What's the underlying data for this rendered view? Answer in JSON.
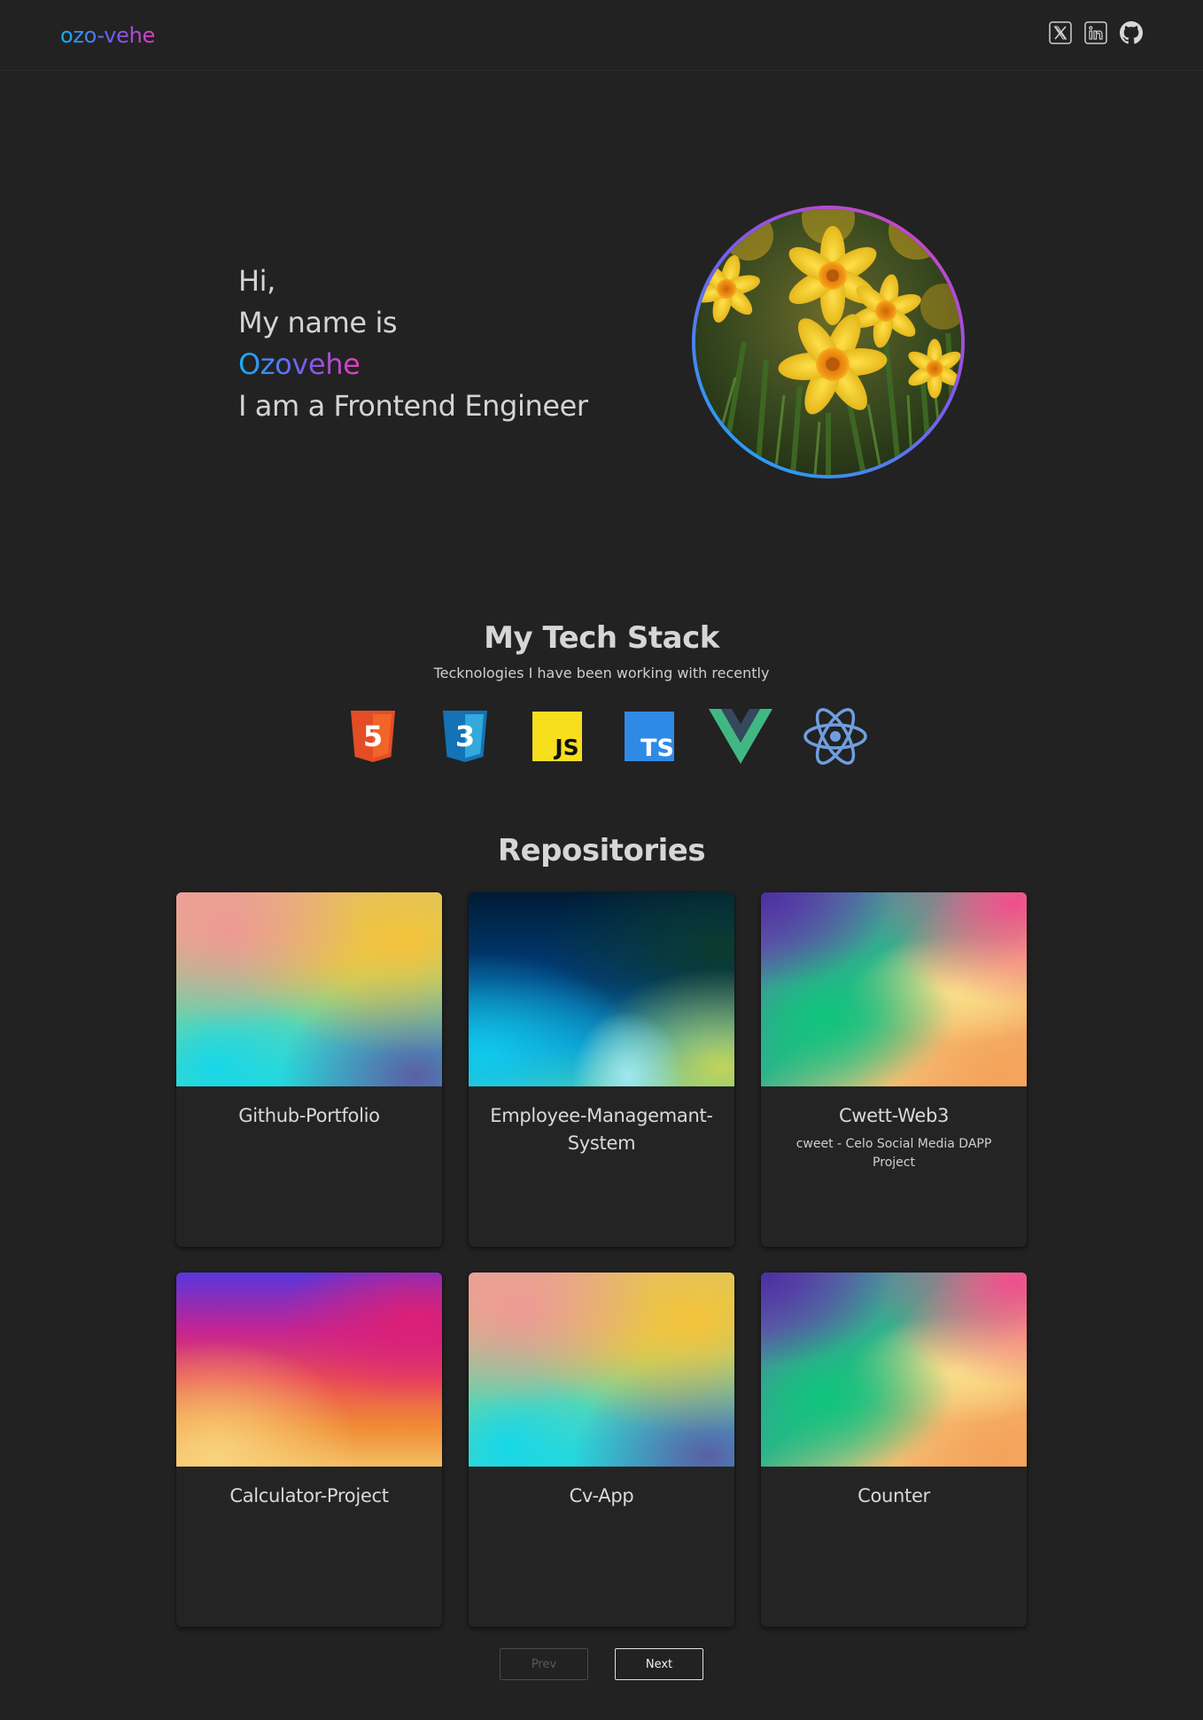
{
  "header": {
    "brand": "ozo-vehe",
    "socials": [
      {
        "name": "x-twitter",
        "icon": "x-icon"
      },
      {
        "name": "linkedin",
        "icon": "linkedin-icon"
      },
      {
        "name": "github",
        "icon": "github-icon"
      }
    ]
  },
  "hero": {
    "line1": "Hi,",
    "line2": "My name is",
    "name": "Ozovehe",
    "line4": "I am a Frontend Engineer",
    "avatar_icon": "daffodils-photo"
  },
  "tech_stack": {
    "title": "My Tech Stack",
    "subtitle": "Tecknologies I have been working with recently",
    "items": [
      {
        "icon": "html5-icon",
        "label": "5",
        "color": "#e44d26"
      },
      {
        "icon": "css3-icon",
        "label": "3",
        "color": "#1572b6"
      },
      {
        "icon": "javascript-icon",
        "label": "JS",
        "color": "#f7df1e"
      },
      {
        "icon": "typescript-icon",
        "label": "TS",
        "color": "#2f8ae6"
      },
      {
        "icon": "vue-icon",
        "color": "#41b883"
      },
      {
        "icon": "react-icon",
        "color": "#6f9ee0"
      }
    ]
  },
  "repositories": {
    "title": "Repositories",
    "cards": [
      {
        "name": "Github-Portfolio",
        "description": ""
      },
      {
        "name": "Employee-Managemant-System",
        "description": ""
      },
      {
        "name": "Cwett-Web3",
        "description": "cweet - Celo Social Media DAPP Project"
      },
      {
        "name": "Calculator-Project",
        "description": ""
      },
      {
        "name": "Cv-App",
        "description": ""
      },
      {
        "name": "Counter",
        "description": ""
      }
    ]
  },
  "pagination": {
    "prev_label": "Prev",
    "next_label": "Next"
  },
  "colors": {
    "background": "#222222",
    "accent_start": "#13b0f5",
    "accent_end": "#e43fb7"
  }
}
